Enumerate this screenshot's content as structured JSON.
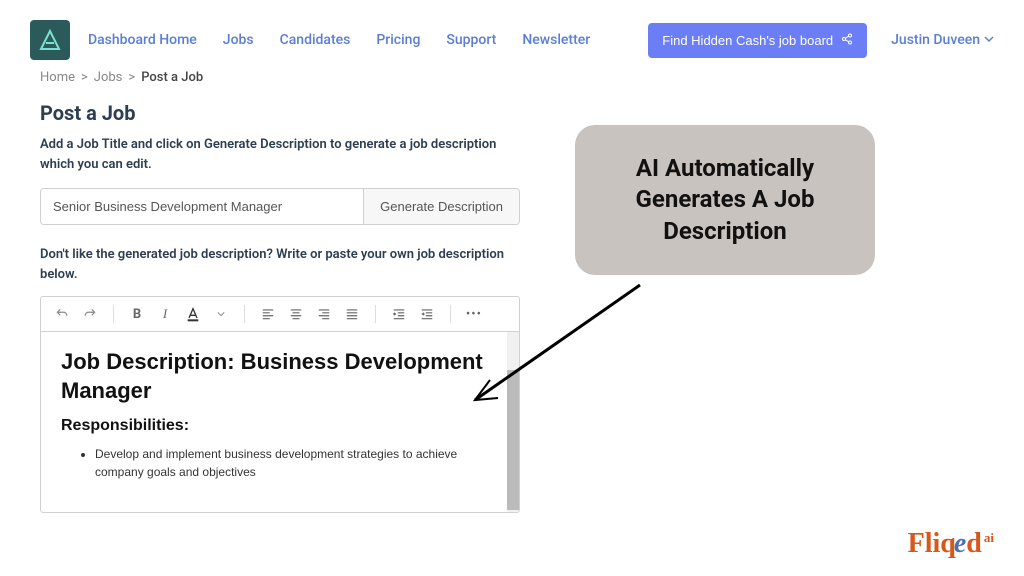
{
  "nav": {
    "items": [
      "Dashboard Home",
      "Jobs",
      "Candidates",
      "Pricing",
      "Support",
      "Newsletter"
    ]
  },
  "header": {
    "find_button": "Find Hidden Cash's job board",
    "user_name": "Justin Duveen"
  },
  "breadcrumb": {
    "home": "Home",
    "jobs": "Jobs",
    "current": "Post a Job"
  },
  "main": {
    "title": "Post a Job",
    "instruction": "Add a Job Title and click on Generate Description to generate a job description which you can edit.",
    "job_title_value": "Senior Business Development Manager",
    "generate_button": "Generate Description",
    "instruction2": "Don't like the generated job description? Write or paste your own job description below."
  },
  "editor": {
    "heading": "Job Description: Business Development Manager",
    "sub": "Responsibilities:",
    "bullet1": "Develop and implement business development strategies to achieve company goals and objectives"
  },
  "callout": {
    "text": "AI Automatically Generates A Job Description"
  },
  "brand": {
    "p1": "Fliq",
    "p2": "e",
    "p3": "d",
    "sup": "ai"
  }
}
